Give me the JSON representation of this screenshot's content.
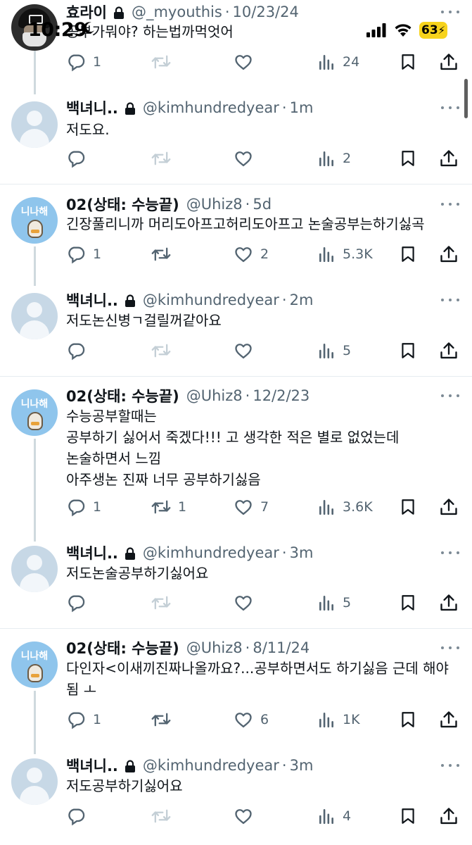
{
  "status_bar": {
    "time": "10:29",
    "battery": "63"
  },
  "tweets": [
    {
      "name": "효라이",
      "handle": "@_myouthis",
      "sep": "·",
      "time": "10/23/24",
      "text": "공부가뭐야? 하는법까먹엇어",
      "replies": "1",
      "retweets": "",
      "likes": "",
      "views": "24"
    },
    {
      "name": "백녀니..",
      "handle": "@kimhundredyear",
      "sep": "·",
      "time": "1m",
      "text": "저도요.",
      "replies": "",
      "retweets": "",
      "likes": "",
      "views": "2"
    },
    {
      "name": "02(상태: 수능끝)",
      "handle": "@Uhiz8",
      "sep": "·",
      "time": "5d",
      "text": "긴장풀리니까 머리도아프고허리도아프고 논술공부는하기싫곡",
      "replies": "1",
      "retweets": "",
      "likes": "2",
      "views": "5.3K"
    },
    {
      "name": "백녀니..",
      "handle": "@kimhundredyear",
      "sep": "·",
      "time": "2m",
      "text": "저도논신병ㄱ걸릴꺼같아요",
      "replies": "",
      "retweets": "",
      "likes": "",
      "views": "5"
    },
    {
      "name": "02(상태: 수능끝)",
      "handle": "@Uhiz8",
      "sep": "·",
      "time": "12/2/23",
      "text": "수능공부할때는\n공부하기 싫어서 죽겠다!!! 고 생각한 적은 별로 없었는데\n논술하면서 느낌\n아주생논 진짜 너무 공부하기싫음",
      "replies": "1",
      "retweets": "1",
      "likes": "7",
      "views": "3.6K"
    },
    {
      "name": "백녀니..",
      "handle": "@kimhundredyear",
      "sep": "·",
      "time": "3m",
      "text": "저도논술공부하기싫어요",
      "replies": "",
      "retweets": "",
      "likes": "",
      "views": "5"
    },
    {
      "name": "02(상태: 수능끝)",
      "handle": "@Uhiz8",
      "sep": "·",
      "time": "8/11/24",
      "text": "다인자<이새끼진짜나올까요?...공부하면서도 하기싫음 근데 해야\n됨 ㅗ",
      "replies": "1",
      "retweets": "",
      "likes": "6",
      "views": "1K"
    },
    {
      "name": "백녀니..",
      "handle": "@kimhundredyear",
      "sep": "·",
      "time": "3m",
      "text": "저도공부하기싫어요",
      "replies": "",
      "retweets": "",
      "likes": "",
      "views": "4"
    }
  ],
  "avatar_label": "니나해",
  "icons": [
    "reply-icon",
    "retweet-icon",
    "like-icon",
    "views-icon",
    "bookmark-icon",
    "share-icon",
    "lock-icon",
    "more-icon"
  ]
}
